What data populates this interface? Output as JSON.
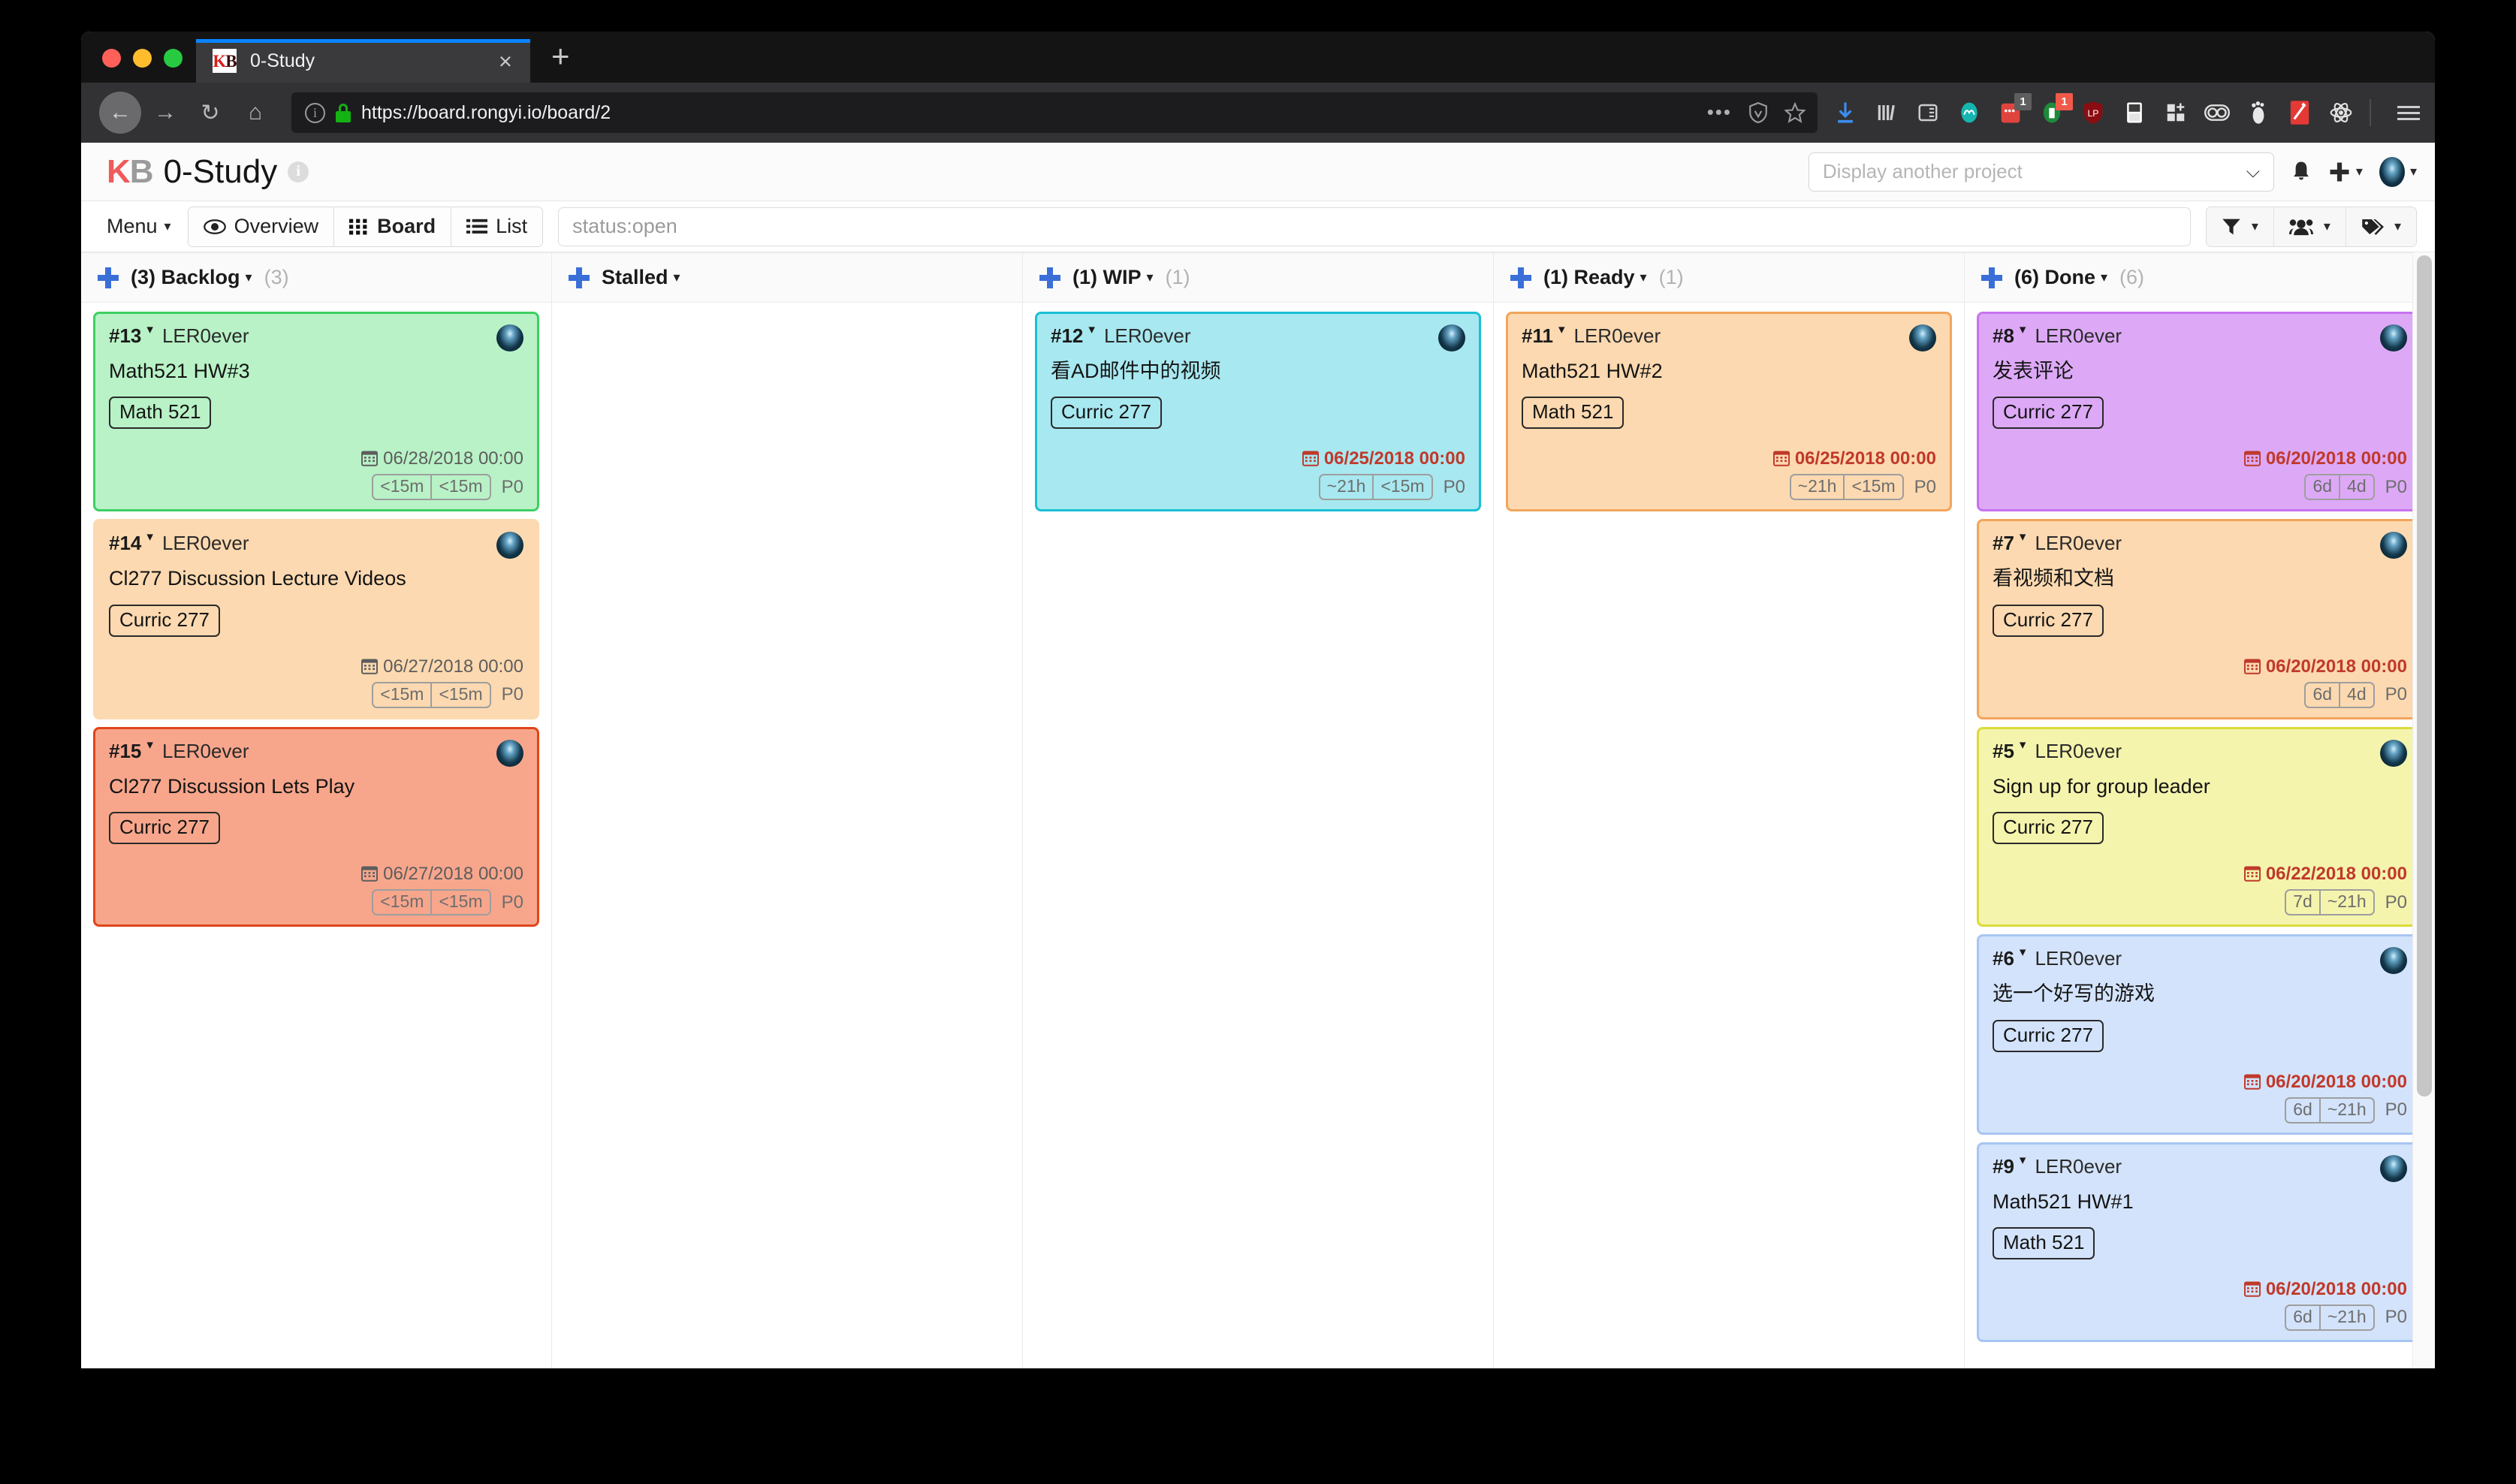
{
  "browser": {
    "tab": {
      "title": "0-Study",
      "favicon_k": "K",
      "favicon_b": "B",
      "close_label": "×"
    },
    "new_tab_label": "+",
    "url": "https://board.rongyi.io/board/2",
    "nav": {
      "back": "←",
      "forward": "→",
      "reload": "↻",
      "home": "⌂"
    },
    "urlbar_right": {
      "more": "•••"
    },
    "extension_badges": [
      "1",
      "1"
    ]
  },
  "app_header": {
    "brand_k": "K",
    "brand_b": "B",
    "project_title": "0-Study",
    "info_icon_label": "i",
    "project_select_placeholder": "Display another project",
    "project_select_caret": "⌵"
  },
  "toolbar": {
    "menu_label": "Menu",
    "menu_caret": "▾",
    "views": [
      {
        "label": "Overview",
        "icon": "eye-icon",
        "active": false
      },
      {
        "label": "Board",
        "icon": "grid-icon",
        "active": true
      },
      {
        "label": "List",
        "icon": "list-icon",
        "active": false
      }
    ],
    "search_value": "status:open",
    "tools": [
      {
        "name": "filter",
        "icon": "funnel-icon",
        "caret": "▾"
      },
      {
        "name": "users",
        "icon": "users-icon",
        "caret": "▾"
      },
      {
        "name": "tags",
        "icon": "tag-icon",
        "caret": "▾"
      }
    ]
  },
  "board": {
    "columns": [
      {
        "title": "(3) Backlog",
        "count": "(3)",
        "caret": "▾",
        "cards": [
          {
            "id": "#13",
            "user": "LER0ever",
            "title": "Math521 HW#3",
            "tag": "Math 521",
            "due": "06/28/2018 00:00",
            "overdue": false,
            "times": [
              "<15m",
              "<15m"
            ],
            "priority": "P0",
            "bg": "#b8f2c6",
            "border": "#3ecf63"
          },
          {
            "id": "#14",
            "user": "LER0ever",
            "title": "Cl277 Discussion Lecture Videos",
            "tag": "Curric 277",
            "due": "06/27/2018 00:00",
            "overdue": false,
            "times": [
              "<15m",
              "<15m"
            ],
            "priority": "P0",
            "bg": "#fcd9b0",
            "border": "#f5a council"
          },
          {
            "id": "#15",
            "user": "LER0ever",
            "title": "Cl277 Discussion Lets Play",
            "tag": "Curric 277",
            "due": "06/27/2018 00:00",
            "overdue": false,
            "times": [
              "<15m",
              "<15m"
            ],
            "priority": "P0",
            "bg": "#f7a68c",
            "border": "#e0451a"
          }
        ]
      },
      {
        "title": "Stalled",
        "count": "",
        "caret": "▾",
        "cards": []
      },
      {
        "title": "(1) WIP",
        "count": "(1)",
        "caret": "▾",
        "cards": [
          {
            "id": "#12",
            "user": "LER0ever",
            "title": "看AD邮件中的视频",
            "tag": "Curric 277",
            "due": "06/25/2018 00:00",
            "overdue": true,
            "times": [
              "~21h",
              "<15m"
            ],
            "priority": "P0",
            "bg": "#a8e8f0",
            "border": "#19c0d4"
          }
        ]
      },
      {
        "title": "(1) Ready",
        "count": "(1)",
        "caret": "▾",
        "cards": [
          {
            "id": "#11",
            "user": "LER0ever",
            "title": "Math521 HW#2",
            "tag": "Math 521",
            "due": "06/25/2018 00:00",
            "overdue": true,
            "times": [
              "~21h",
              "<15m"
            ],
            "priority": "P0",
            "bg": "#fcd9b0",
            "border": "#f2a55c"
          }
        ]
      },
      {
        "title": "(6) Done",
        "count": "(6)",
        "caret": "▾",
        "cards": [
          {
            "id": "#8",
            "user": "LER0ever",
            "title": "发表评论",
            "tag": "Curric 277",
            "due": "06/20/2018 00:00",
            "overdue": true,
            "times": [
              "6d",
              "4d"
            ],
            "priority": "P0",
            "bg": "#dda9f7",
            "border": "#c873ee"
          },
          {
            "id": "#7",
            "user": "LER0ever",
            "title": "看视频和文档",
            "tag": "Curric 277",
            "due": "06/20/2018 00:00",
            "overdue": true,
            "times": [
              "6d",
              "4d"
            ],
            "priority": "P0",
            "bg": "#fcd9b0",
            "border": "#f2a55c"
          },
          {
            "id": "#5",
            "user": "LER0ever",
            "title": "Sign up for group leader",
            "tag": "Curric 277",
            "due": "06/22/2018 00:00",
            "overdue": true,
            "times": [
              "7d",
              "~21h"
            ],
            "priority": "P0",
            "bg": "#f4f4ad",
            "border": "#dbdb39"
          },
          {
            "id": "#6",
            "user": "LER0ever",
            "title": "选一个好写的游戏",
            "tag": "Curric 277",
            "due": "06/20/2018 00:00",
            "overdue": true,
            "times": [
              "6d",
              "~21h"
            ],
            "priority": "P0",
            "bg": "#d3e3fb",
            "border": "#a7c6f3"
          },
          {
            "id": "#9",
            "user": "LER0ever",
            "title": "Math521 HW#1",
            "tag": "Math 521",
            "due": "06/20/2018 00:00",
            "overdue": true,
            "times": [
              "6d",
              "~21h"
            ],
            "priority": "P0",
            "bg": "#d3e3fb",
            "border": "#a7c6f3"
          }
        ]
      }
    ]
  }
}
